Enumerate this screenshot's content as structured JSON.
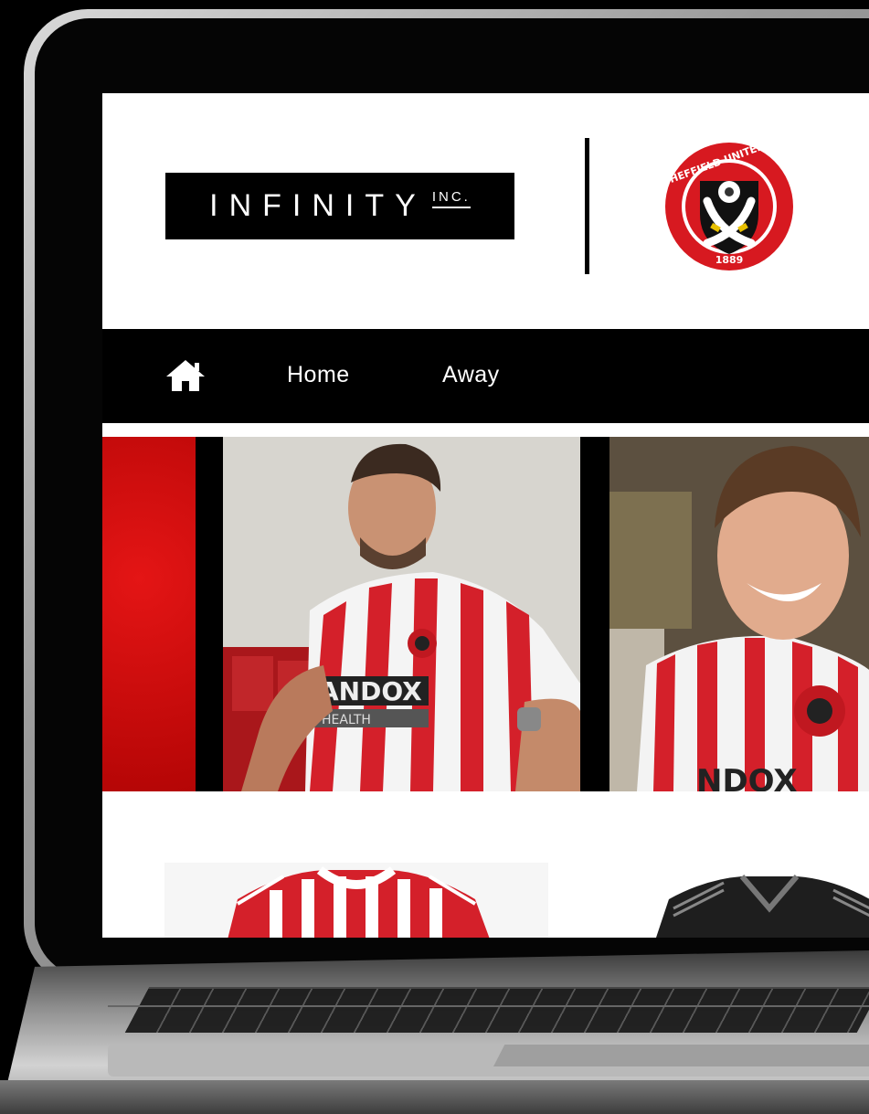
{
  "header": {
    "brand": {
      "name": "INFINITY",
      "suffix": "INC."
    },
    "club_crest": {
      "icon": "club-crest-icon",
      "year": "1889",
      "text": "SHEFFIELD UNITED F.C."
    }
  },
  "nav": {
    "home_icon": "home-icon",
    "items": [
      {
        "label": "Home"
      },
      {
        "label": "Away"
      }
    ]
  },
  "hero": {
    "accent_color": "#d60c0c",
    "photos": [
      {
        "subject": "player-in-home-kit",
        "shirt_text": "ANDOX",
        "shirt_subtext": "HEALTH"
      },
      {
        "subject": "player-smiling",
        "shirt_text": "NDOX"
      }
    ]
  },
  "products": [
    {
      "name": "home-kit-shirt"
    },
    {
      "name": "away-kit-shirt"
    }
  ],
  "colors": {
    "club_red": "#d71920",
    "nav_bg": "#000000",
    "page_bg": "#ffffff"
  }
}
